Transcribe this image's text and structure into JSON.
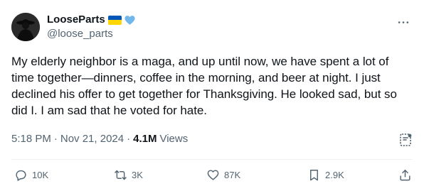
{
  "author": {
    "display_name": "LooseParts",
    "handle": "@loose_parts",
    "badges": [
      "ukraine-flag",
      "blue-heart"
    ]
  },
  "tweet": {
    "text": "My elderly neighbor is a maga, and up until now, we have spent a lot of time together—dinners, coffee in the morning, and beer at night. I just declined his offer to get together for Thanksgiving. He looked sad, but so did I. I am sad that he voted for hate."
  },
  "meta": {
    "time": "5:18 PM",
    "separator": "·",
    "date": "Nov 21, 2024",
    "views_count": "4.1M",
    "views_label": "Views"
  },
  "actions": {
    "replies": "10K",
    "reposts": "3K",
    "likes": "87K",
    "bookmarks": "2.9K"
  },
  "colors": {
    "text": "#0f1419",
    "secondary": "#536471",
    "divider": "#eff3f4",
    "heart_badge": "#71b7ec"
  }
}
